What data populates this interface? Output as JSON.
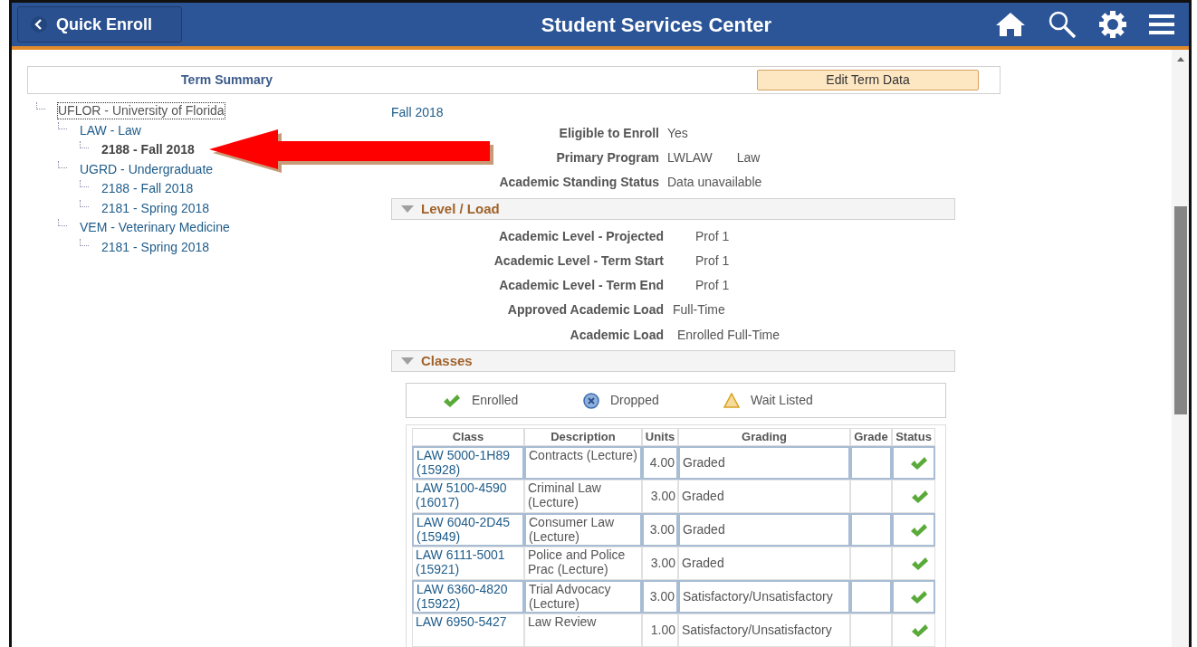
{
  "header": {
    "back_button": "Quick Enroll",
    "title": "Student Services Center"
  },
  "term_summary": {
    "title": "Term Summary",
    "edit_button": "Edit Term Data"
  },
  "tree": [
    {
      "label": "UFLOR - University of Florida",
      "selected": false,
      "focused": true,
      "children": [
        {
          "label": "LAW - Law",
          "selected": false,
          "children": [
            {
              "label": "2188 - Fall 2018",
              "selected": true
            }
          ]
        },
        {
          "label": "UGRD - Undergraduate",
          "selected": false,
          "children": [
            {
              "label": "2188 - Fall 2018",
              "selected": false
            },
            {
              "label": "2181 - Spring 2018",
              "selected": false
            }
          ]
        },
        {
          "label": "VEM - Veterinary Medicine",
          "selected": false,
          "children": [
            {
              "label": "2181 - Spring 2018",
              "selected": false
            }
          ]
        }
      ]
    }
  ],
  "term": "Fall 2018",
  "summary_fields": [
    {
      "label": "Eligible to Enroll",
      "value": "Yes"
    },
    {
      "label": "Primary Program",
      "value": "LWLAW",
      "value_2": "Law"
    },
    {
      "label": "Academic Standing Status",
      "value": "Data unavailable"
    }
  ],
  "level_load": {
    "title": "Level / Load",
    "expanded": true,
    "fields": [
      {
        "label": "Academic Level - Projected",
        "value": "Prof 1"
      },
      {
        "label": "Academic Level - Term Start",
        "value": "Prof 1"
      },
      {
        "label": "Academic Level - Term End",
        "value": "Prof 1"
      },
      {
        "label": "Approved Academic Load",
        "value": "Full-Time"
      },
      {
        "label": "Academic Load",
        "value": "Enrolled Full-Time"
      }
    ]
  },
  "classes": {
    "title": "Classes",
    "expanded": true,
    "legend": [
      {
        "kind": "enrolled",
        "label": "Enrolled"
      },
      {
        "kind": "dropped",
        "label": "Dropped"
      },
      {
        "kind": "waitlisted",
        "label": "Wait Listed"
      }
    ],
    "columns": [
      "Class",
      "Description",
      "Units",
      "Grading",
      "Grade",
      "Status"
    ],
    "rows": [
      {
        "class": "LAW 5000-1H89 (15928)",
        "description": "Contracts (Lecture)",
        "units": "4.00",
        "grading": "Graded",
        "kind": "enrolled"
      },
      {
        "class": "LAW 5100-4590 (16017)",
        "description": "Criminal Law (Lecture)",
        "units": "3.00",
        "grading": "Graded",
        "kind": "enrolled"
      },
      {
        "class": "LAW 6040-2D45 (15949)",
        "description": "Consumer Law (Lecture)",
        "units": "3.00",
        "grading": "Graded",
        "kind": "enrolled"
      },
      {
        "class": "LAW 6111-5001 (15921)",
        "description": "Police and Police Prac (Lecture)",
        "units": "3.00",
        "grading": "Graded",
        "kind": "enrolled"
      },
      {
        "class": "LAW 6360-4820 (15922)",
        "description": "Trial Advocacy (Lecture)",
        "units": "3.00",
        "grading": "Satisfactory/Unsatisfactory",
        "kind": "enrolled"
      },
      {
        "class": "LAW 6950-5427",
        "description": "Law Review",
        "units": "1.00",
        "grading": "Satisfactory/Unsatisfactory",
        "kind": "enrolled"
      }
    ]
  }
}
